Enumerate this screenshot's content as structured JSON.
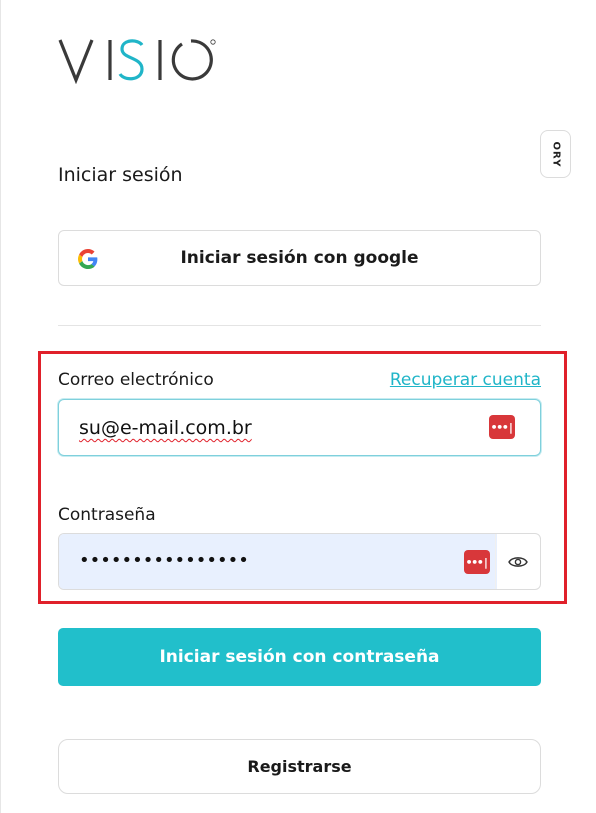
{
  "brand": {
    "logo_text": "VISIO",
    "logo_colors": {
      "dark": "#3a3a3a",
      "accent": "#20b5c8"
    }
  },
  "badge": {
    "label": "ORY"
  },
  "login": {
    "title": "Iniciar sesión",
    "google_button_label": "Iniciar sesión con google",
    "email": {
      "label": "Correo electrónico",
      "value": "su@e-mail.com.br",
      "recover_link": "Recuperar cuenta"
    },
    "password": {
      "label": "Contraseña",
      "masked_value": "••••••••••••••••"
    },
    "submit_label": "Iniciar sesión con contraseña",
    "register_label": "Registrarse"
  },
  "icons": {
    "password_manager": "password-manager-icon",
    "reveal_password": "eye-icon",
    "google": "google-icon"
  },
  "colors": {
    "accent": "#21bfcb",
    "highlight": "#e0202a",
    "autofill_bg": "#e8f0fe",
    "pw_manager": "#d8373a"
  }
}
